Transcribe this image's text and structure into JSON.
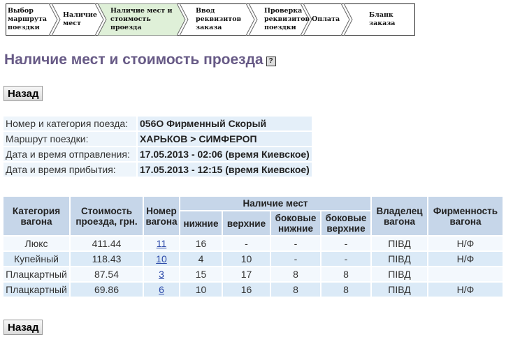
{
  "steps": [
    {
      "label": "Выбор маршрута поездки",
      "active": false
    },
    {
      "label": "Наличие мест",
      "active": false
    },
    {
      "label": "Наличие мест и стоимость проезда",
      "active": true
    },
    {
      "label": "Ввод реквизитов заказа",
      "active": false
    },
    {
      "label": "Проверка реквизитов поездки",
      "active": false
    },
    {
      "label": "Оплата",
      "active": false
    },
    {
      "label": "Бланк заказа",
      "active": false
    }
  ],
  "title": "Наличие мест и стоимость проезда",
  "help_icon": "?",
  "back_label": "Назад",
  "info": [
    {
      "label": "Номер и категория поезда:",
      "value": "056О Фирменный Скорый"
    },
    {
      "label": "Маршрут поездки:",
      "value": "ХАРЬКОВ > СИМФЕРОП"
    },
    {
      "label": "Дата и время отправления:",
      "value": "17.05.2013 - 02:06 (время Киевское)"
    },
    {
      "label": "Дата и время прибытия:",
      "value": "17.05.2013 - 12:15 (время Киевское)"
    }
  ],
  "table": {
    "headers": {
      "category": "Категория вагона",
      "price": "Стоимость проезда, грн.",
      "number": "Номер вагона",
      "seats": "Наличие мест",
      "lower": "нижние",
      "upper": "верхние",
      "side_lower": "боковые нижние",
      "side_upper": "боковые верхние",
      "owner": "Владелец вагона",
      "brand": "Фирменность вагона"
    },
    "rows": [
      {
        "category": "Люкс",
        "price": "411.44",
        "number": "11",
        "lower": "16",
        "upper": "-",
        "side_lower": "-",
        "side_upper": "-",
        "owner": "ПІВД",
        "brand": "Н/Ф"
      },
      {
        "category": "Купейный",
        "price": "118.43",
        "number": "10",
        "lower": "4",
        "upper": "10",
        "side_lower": "-",
        "side_upper": "-",
        "owner": "ПІВД",
        "brand": "Н/Ф"
      },
      {
        "category": "Плацкартный",
        "price": "87.54",
        "number": "3",
        "lower": "15",
        "upper": "17",
        "side_lower": "8",
        "side_upper": "8",
        "owner": "ПІВД",
        "brand": ""
      },
      {
        "category": "Плацкартный",
        "price": "69.86",
        "number": "6",
        "lower": "10",
        "upper": "16",
        "side_lower": "8",
        "side_upper": "8",
        "owner": "ПІВД",
        "brand": "Н/Ф"
      }
    ]
  },
  "colors": {
    "active_step": "#dff0d8",
    "title": "#675a86",
    "header": "#c6d6e9",
    "row_alt": "#dbeaf7"
  }
}
